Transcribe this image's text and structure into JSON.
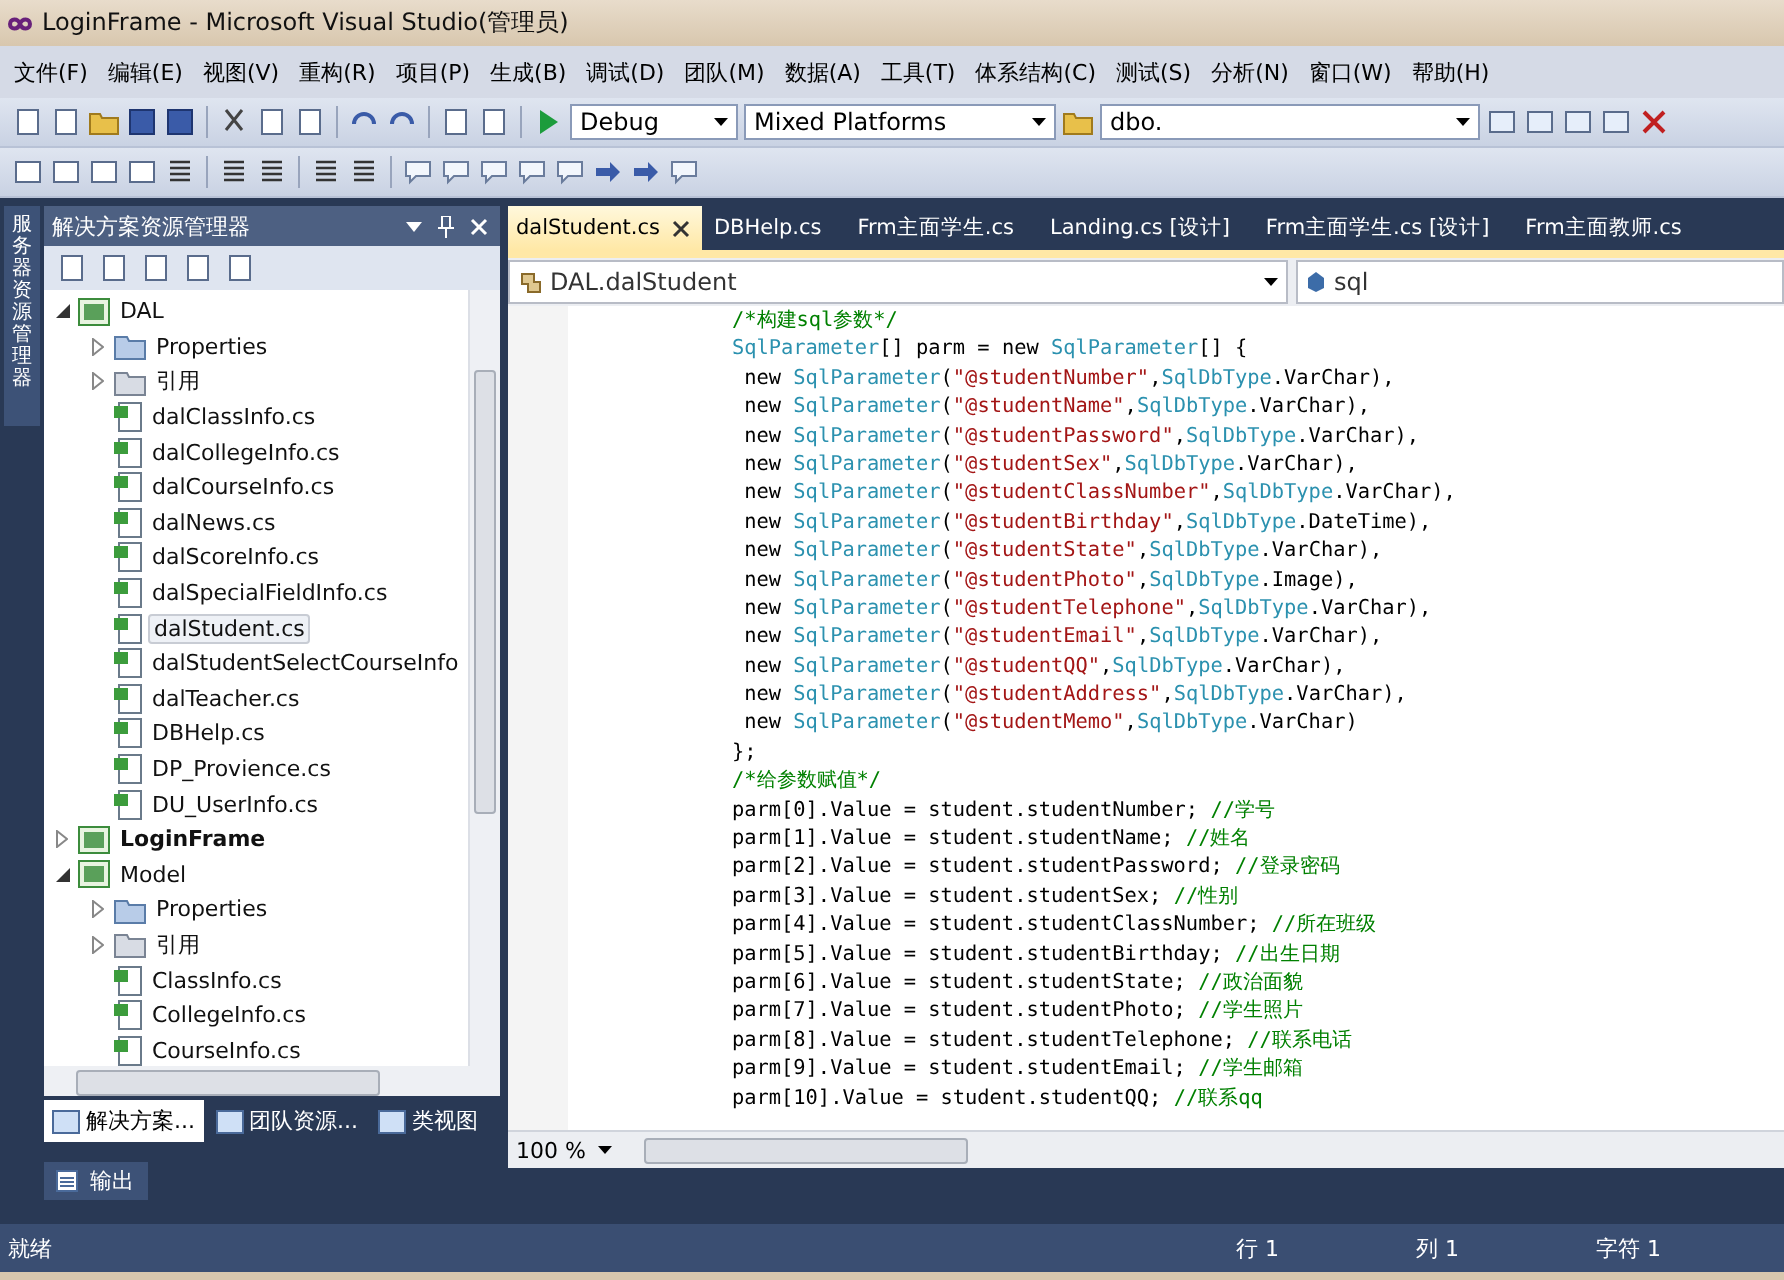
{
  "window": {
    "title": "LoginFrame - Microsoft Visual Studio(管理员)"
  },
  "menu": [
    "文件(F)",
    "编辑(E)",
    "视图(V)",
    "重构(R)",
    "项目(P)",
    "生成(B)",
    "调试(D)",
    "团队(M)",
    "数据(A)",
    "工具(T)",
    "体系结构(C)",
    "测试(S)",
    "分析(N)",
    "窗口(W)",
    "帮助(H)"
  ],
  "toolbar": {
    "configuration": "Debug",
    "platform": "Mixed Platforms",
    "schema": "dbo."
  },
  "side_strip": {
    "label": "服务器资源管理器"
  },
  "solution_explorer": {
    "title": "解决方案资源管理器",
    "tree": [
      {
        "label": "DAL",
        "kind": "project",
        "expanded": true,
        "bold": false,
        "selected": false,
        "children": [
          {
            "label": "Properties",
            "kind": "properties",
            "expanded": false,
            "selected": false
          },
          {
            "label": "引用",
            "kind": "references",
            "expanded": false,
            "selected": false
          },
          {
            "label": "dalClassInfo.cs",
            "kind": "file",
            "selected": false
          },
          {
            "label": "dalCollegeInfo.cs",
            "kind": "file",
            "selected": false
          },
          {
            "label": "dalCourseInfo.cs",
            "kind": "file",
            "selected": false
          },
          {
            "label": "dalNews.cs",
            "kind": "file",
            "selected": false
          },
          {
            "label": "dalScoreInfo.cs",
            "kind": "file",
            "selected": false
          },
          {
            "label": "dalSpecialFieldInfo.cs",
            "kind": "file",
            "selected": false
          },
          {
            "label": "dalStudent.cs",
            "kind": "file",
            "selected": true
          },
          {
            "label": "dalStudentSelectCourseInfo",
            "kind": "file",
            "selected": false
          },
          {
            "label": "dalTeacher.cs",
            "kind": "file",
            "selected": false
          },
          {
            "label": "DBHelp.cs",
            "kind": "file",
            "selected": false
          },
          {
            "label": "DP_Provience.cs",
            "kind": "file",
            "selected": false
          },
          {
            "label": "DU_UserInfo.cs",
            "kind": "file",
            "selected": false
          }
        ]
      },
      {
        "label": "LoginFrame",
        "kind": "project",
        "expanded": false,
        "bold": true,
        "selected": false
      },
      {
        "label": "Model",
        "kind": "project",
        "expanded": true,
        "bold": false,
        "selected": false,
        "children": [
          {
            "label": "Properties",
            "kind": "properties",
            "expanded": false,
            "selected": false
          },
          {
            "label": "引用",
            "kind": "references",
            "expanded": false,
            "selected": false
          },
          {
            "label": "ClassInfo.cs",
            "kind": "file",
            "selected": false
          },
          {
            "label": "CollegeInfo.cs",
            "kind": "file",
            "selected": false
          },
          {
            "label": "CourseInfo.cs",
            "kind": "file",
            "selected": false
          }
        ]
      }
    ],
    "bottom_tabs": [
      {
        "label": "解决方案...",
        "selected": true
      },
      {
        "label": "团队资源...",
        "selected": false
      },
      {
        "label": "类视图",
        "selected": false
      }
    ]
  },
  "output_tab": {
    "label": "输出"
  },
  "editor": {
    "tabs": [
      {
        "label": "dalStudent.cs",
        "selected": true
      },
      {
        "label": "DBHelp.cs",
        "selected": false
      },
      {
        "label": "Frm主面学生.cs",
        "selected": false
      },
      {
        "label": "Landing.cs [设计]",
        "selected": false
      },
      {
        "label": "Frm主面学生.cs [设计]",
        "selected": false
      },
      {
        "label": "Frm主面教师.cs",
        "selected": false
      }
    ],
    "type_selector": "DAL.dalStudent",
    "member_selector": "sql",
    "lines": [
      [
        {
          "kind": "comment",
          "text": "/*构建sql参数*/"
        }
      ],
      [
        {
          "kind": "type",
          "text": "SqlParameter"
        },
        {
          "kind": "plain",
          "text": "[] parm = new "
        },
        {
          "kind": "type",
          "text": "SqlParameter"
        },
        {
          "kind": "plain",
          "text": "[] {"
        }
      ],
      [
        {
          "kind": "plain",
          "text": " new "
        },
        {
          "kind": "type",
          "text": "SqlParameter"
        },
        {
          "kind": "plain",
          "text": "("
        },
        {
          "kind": "string",
          "text": "\"@studentNumber\""
        },
        {
          "kind": "plain",
          "text": ","
        },
        {
          "kind": "type",
          "text": "SqlDbType"
        },
        {
          "kind": "plain",
          "text": ".VarChar),"
        }
      ],
      [
        {
          "kind": "plain",
          "text": " new "
        },
        {
          "kind": "type",
          "text": "SqlParameter"
        },
        {
          "kind": "plain",
          "text": "("
        },
        {
          "kind": "string",
          "text": "\"@studentName\""
        },
        {
          "kind": "plain",
          "text": ","
        },
        {
          "kind": "type",
          "text": "SqlDbType"
        },
        {
          "kind": "plain",
          "text": ".VarChar),"
        }
      ],
      [
        {
          "kind": "plain",
          "text": " new "
        },
        {
          "kind": "type",
          "text": "SqlParameter"
        },
        {
          "kind": "plain",
          "text": "("
        },
        {
          "kind": "string",
          "text": "\"@studentPassword\""
        },
        {
          "kind": "plain",
          "text": ","
        },
        {
          "kind": "type",
          "text": "SqlDbType"
        },
        {
          "kind": "plain",
          "text": ".VarChar),"
        }
      ],
      [
        {
          "kind": "plain",
          "text": " new "
        },
        {
          "kind": "type",
          "text": "SqlParameter"
        },
        {
          "kind": "plain",
          "text": "("
        },
        {
          "kind": "string",
          "text": "\"@studentSex\""
        },
        {
          "kind": "plain",
          "text": ","
        },
        {
          "kind": "type",
          "text": "SqlDbType"
        },
        {
          "kind": "plain",
          "text": ".VarChar),"
        }
      ],
      [
        {
          "kind": "plain",
          "text": " new "
        },
        {
          "kind": "type",
          "text": "SqlParameter"
        },
        {
          "kind": "plain",
          "text": "("
        },
        {
          "kind": "string",
          "text": "\"@studentClassNumber\""
        },
        {
          "kind": "plain",
          "text": ","
        },
        {
          "kind": "type",
          "text": "SqlDbType"
        },
        {
          "kind": "plain",
          "text": ".VarChar),"
        }
      ],
      [
        {
          "kind": "plain",
          "text": " new "
        },
        {
          "kind": "type",
          "text": "SqlParameter"
        },
        {
          "kind": "plain",
          "text": "("
        },
        {
          "kind": "string",
          "text": "\"@studentBirthday\""
        },
        {
          "kind": "plain",
          "text": ","
        },
        {
          "kind": "type",
          "text": "SqlDbType"
        },
        {
          "kind": "plain",
          "text": ".DateTime),"
        }
      ],
      [
        {
          "kind": "plain",
          "text": " new "
        },
        {
          "kind": "type",
          "text": "SqlParameter"
        },
        {
          "kind": "plain",
          "text": "("
        },
        {
          "kind": "string",
          "text": "\"@studentState\""
        },
        {
          "kind": "plain",
          "text": ","
        },
        {
          "kind": "type",
          "text": "SqlDbType"
        },
        {
          "kind": "plain",
          "text": ".VarChar),"
        }
      ],
      [
        {
          "kind": "plain",
          "text": " new "
        },
        {
          "kind": "type",
          "text": "SqlParameter"
        },
        {
          "kind": "plain",
          "text": "("
        },
        {
          "kind": "string",
          "text": "\"@studentPhoto\""
        },
        {
          "kind": "plain",
          "text": ","
        },
        {
          "kind": "type",
          "text": "SqlDbType"
        },
        {
          "kind": "plain",
          "text": ".Image),"
        }
      ],
      [
        {
          "kind": "plain",
          "text": " new "
        },
        {
          "kind": "type",
          "text": "SqlParameter"
        },
        {
          "kind": "plain",
          "text": "("
        },
        {
          "kind": "string",
          "text": "\"@studentTelephone\""
        },
        {
          "kind": "plain",
          "text": ","
        },
        {
          "kind": "type",
          "text": "SqlDbType"
        },
        {
          "kind": "plain",
          "text": ".VarChar),"
        }
      ],
      [
        {
          "kind": "plain",
          "text": " new "
        },
        {
          "kind": "type",
          "text": "SqlParameter"
        },
        {
          "kind": "plain",
          "text": "("
        },
        {
          "kind": "string",
          "text": "\"@studentEmail\""
        },
        {
          "kind": "plain",
          "text": ","
        },
        {
          "kind": "type",
          "text": "SqlDbType"
        },
        {
          "kind": "plain",
          "text": ".VarChar),"
        }
      ],
      [
        {
          "kind": "plain",
          "text": " new "
        },
        {
          "kind": "type",
          "text": "SqlParameter"
        },
        {
          "kind": "plain",
          "text": "("
        },
        {
          "kind": "string",
          "text": "\"@studentQQ\""
        },
        {
          "kind": "plain",
          "text": ","
        },
        {
          "kind": "type",
          "text": "SqlDbType"
        },
        {
          "kind": "plain",
          "text": ".VarChar),"
        }
      ],
      [
        {
          "kind": "plain",
          "text": " new "
        },
        {
          "kind": "type",
          "text": "SqlParameter"
        },
        {
          "kind": "plain",
          "text": "("
        },
        {
          "kind": "string",
          "text": "\"@studentAddress\""
        },
        {
          "kind": "plain",
          "text": ","
        },
        {
          "kind": "type",
          "text": "SqlDbType"
        },
        {
          "kind": "plain",
          "text": ".VarChar),"
        }
      ],
      [
        {
          "kind": "plain",
          "text": " new "
        },
        {
          "kind": "type",
          "text": "SqlParameter"
        },
        {
          "kind": "plain",
          "text": "("
        },
        {
          "kind": "string",
          "text": "\"@studentMemo\""
        },
        {
          "kind": "plain",
          "text": ","
        },
        {
          "kind": "type",
          "text": "SqlDbType"
        },
        {
          "kind": "plain",
          "text": ".VarChar)"
        }
      ],
      [
        {
          "kind": "plain",
          "text": "};"
        }
      ],
      [
        {
          "kind": "comment",
          "text": "/*给参数赋值*/"
        }
      ],
      [
        {
          "kind": "plain",
          "text": "parm[0].Value = student.studentNumber; "
        },
        {
          "kind": "comment",
          "text": "//学号"
        }
      ],
      [
        {
          "kind": "plain",
          "text": "parm[1].Value = student.studentName; "
        },
        {
          "kind": "comment",
          "text": "//姓名"
        }
      ],
      [
        {
          "kind": "plain",
          "text": "parm[2].Value = student.studentPassword; "
        },
        {
          "kind": "comment",
          "text": "//登录密码"
        }
      ],
      [
        {
          "kind": "plain",
          "text": "parm[3].Value = student.studentSex; "
        },
        {
          "kind": "comment",
          "text": "//性别"
        }
      ],
      [
        {
          "kind": "plain",
          "text": "parm[4].Value = student.studentClassNumber; "
        },
        {
          "kind": "comment",
          "text": "//所在班级"
        }
      ],
      [
        {
          "kind": "plain",
          "text": "parm[5].Value = student.studentBirthday; "
        },
        {
          "kind": "comment",
          "text": "//出生日期"
        }
      ],
      [
        {
          "kind": "plain",
          "text": "parm[6].Value = student.studentState; "
        },
        {
          "kind": "comment",
          "text": "//政治面貌"
        }
      ],
      [
        {
          "kind": "plain",
          "text": "parm[7].Value = student.studentPhoto; "
        },
        {
          "kind": "comment",
          "text": "//学生照片"
        }
      ],
      [
        {
          "kind": "plain",
          "text": "parm[8].Value = student.studentTelephone; "
        },
        {
          "kind": "comment",
          "text": "//联系电话"
        }
      ],
      [
        {
          "kind": "plain",
          "text": "parm[9].Value = student.studentEmail; "
        },
        {
          "kind": "comment",
          "text": "//学生邮箱"
        }
      ],
      [
        {
          "kind": "plain",
          "text": "parm[10].Value = student.studentQQ; "
        },
        {
          "kind": "comment",
          "text": "//联系qq"
        }
      ]
    ],
    "zoom": "100 %"
  },
  "status_bar": {
    "message": "就绪",
    "line": "行 1",
    "column": "列 1",
    "char": "字符 1"
  }
}
